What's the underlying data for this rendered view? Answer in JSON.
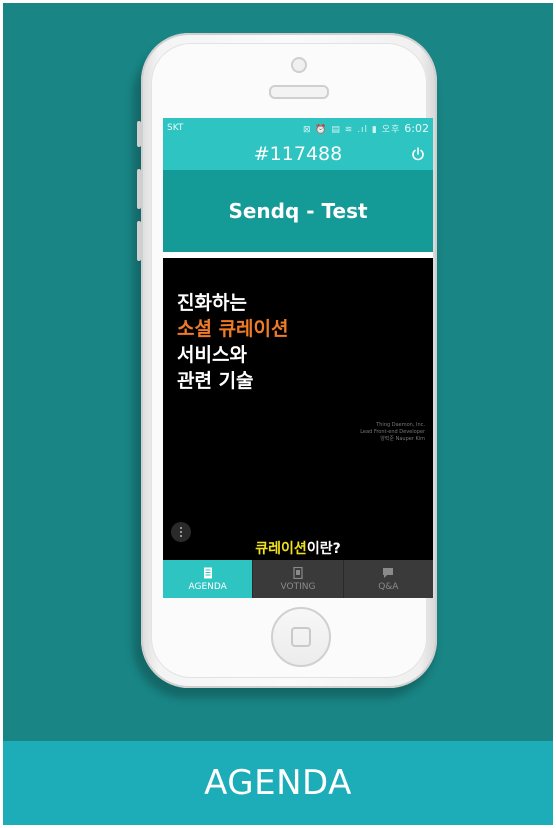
{
  "banner": {
    "label": "AGENDA"
  },
  "status_bar": {
    "carrier": "SKT",
    "icons": "⊠ ⏰ ▤ ≋ .ıl ▮ 오후",
    "time": "6:02"
  },
  "app": {
    "room_code": "#117488",
    "event_title": "Sendq - Test"
  },
  "slide": {
    "line1": "진화하는",
    "line2": "소셜 큐레이션",
    "line3": "서비스와",
    "line4": "관련 기술",
    "credits": [
      "Thing Daemon, Inc.",
      "Lead Front-end Developer",
      "양력준 Nauper Kim"
    ],
    "caption_highlight": "큐레이션",
    "caption_rest": "이란?"
  },
  "tabs": [
    {
      "label": "AGENDA",
      "icon": "document-icon",
      "active": true
    },
    {
      "label": "VOTING",
      "icon": "ballot-icon",
      "active": false
    },
    {
      "label": "Q&A",
      "icon": "chat-icon",
      "active": false
    }
  ],
  "colors": {
    "background_teal": "#198585",
    "banner_teal": "#1cadb8",
    "app_teal": "#2ec4c1",
    "header_teal": "#149a97",
    "accent_orange": "#f07b27",
    "accent_yellow": "#f2e21a"
  }
}
